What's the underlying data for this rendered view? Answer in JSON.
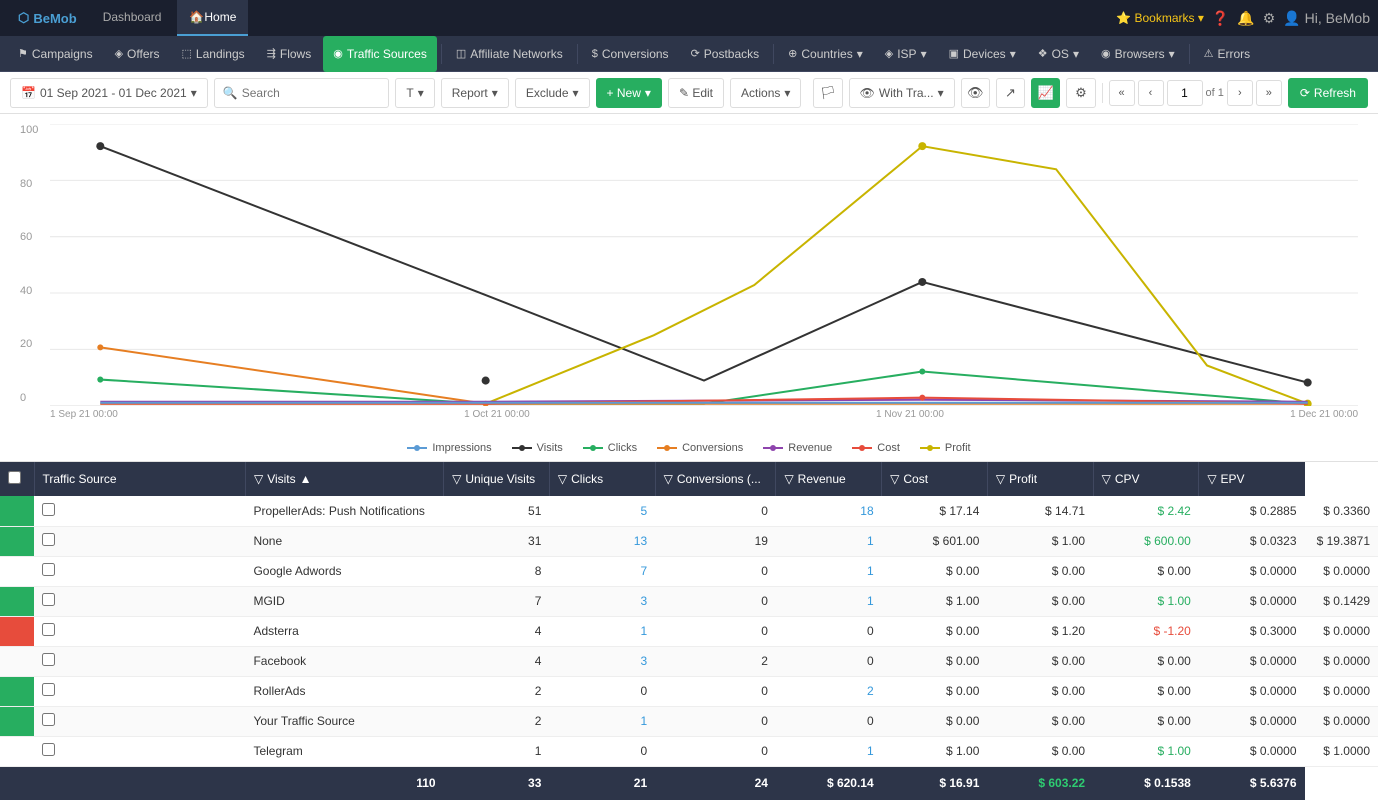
{
  "topbar": {
    "brand": "BeMob",
    "tabs": [
      {
        "label": "Dashboard",
        "active": false
      },
      {
        "label": "Home",
        "active": true
      }
    ],
    "bookmarks": "Bookmarks",
    "hi": "Hi, BeMob"
  },
  "navbar": {
    "items": [
      {
        "label": "Campaigns",
        "icon": "⚑",
        "active": false
      },
      {
        "label": "Offers",
        "icon": "◈",
        "active": false
      },
      {
        "label": "Landings",
        "icon": "⬚",
        "active": false
      },
      {
        "label": "Flows",
        "icon": "⇶",
        "active": false
      },
      {
        "label": "Traffic Sources",
        "icon": "◉",
        "active": true
      },
      {
        "label": "Affiliate Networks",
        "icon": "◫",
        "active": false
      },
      {
        "label": "Conversions",
        "icon": "$",
        "active": false
      },
      {
        "label": "Postbacks",
        "icon": "⟳",
        "active": false
      },
      {
        "label": "Countries",
        "icon": "⊕",
        "active": false
      },
      {
        "label": "ISP",
        "icon": "◈",
        "active": false
      },
      {
        "label": "Devices",
        "icon": "▣",
        "active": false
      },
      {
        "label": "OS",
        "icon": "❖",
        "active": false
      },
      {
        "label": "Browsers",
        "icon": "◉",
        "active": false
      },
      {
        "label": "Errors",
        "icon": "⚠",
        "active": false
      }
    ]
  },
  "toolbar": {
    "date_range": "01 Sep 2021 - 01 Dec 2021",
    "search_placeholder": "Search",
    "buttons": {
      "type": "T",
      "report": "Report",
      "exclude": "Exclude",
      "new": "+ New",
      "edit": "✎ Edit",
      "actions": "Actions",
      "with_tra": "With Tra...",
      "refresh": "Refresh"
    },
    "page_current": "1",
    "page_total": "1"
  },
  "chart": {
    "y_labels": [
      "100",
      "80",
      "60",
      "40",
      "20",
      "0"
    ],
    "x_labels": [
      "1 Sep 21 00:00",
      "1 Oct 21 00:00",
      "1 Nov 21 00:00",
      "1 Dec 21 00:00"
    ],
    "legend": [
      {
        "label": "Impressions",
        "color": "#5b9bd5"
      },
      {
        "label": "Visits",
        "color": "#333"
      },
      {
        "label": "Clicks",
        "color": "#27ae60"
      },
      {
        "label": "Conversions",
        "color": "#e67e22"
      },
      {
        "label": "Revenue",
        "color": "#8e44ad"
      },
      {
        "label": "Cost",
        "color": "#e74c3c"
      },
      {
        "label": "Profit",
        "color": "#c8b400"
      }
    ]
  },
  "table": {
    "columns": [
      {
        "label": "Traffic Source",
        "key": "source"
      },
      {
        "label": "Visits",
        "key": "visits"
      },
      {
        "label": "Unique Visits",
        "key": "unique_visits"
      },
      {
        "label": "Clicks",
        "key": "clicks"
      },
      {
        "label": "Conversions (...",
        "key": "conversions"
      },
      {
        "label": "Revenue",
        "key": "revenue"
      },
      {
        "label": "Cost",
        "key": "cost"
      },
      {
        "label": "Profit",
        "key": "profit"
      },
      {
        "label": "CPV",
        "key": "cpv"
      },
      {
        "label": "EPV",
        "key": "epv"
      }
    ],
    "rows": [
      {
        "source": "PropellerAds: Push Notifications",
        "visits": "51",
        "unique_visits": "5",
        "clicks": "0",
        "conversions": "18",
        "revenue": "$ 17.14",
        "cost": "$ 14.71",
        "profit": "$ 2.42",
        "cpv": "$ 0.2885",
        "epv": "$ 0.3360",
        "profit_type": "positive",
        "add": true,
        "sub": false
      },
      {
        "source": "None",
        "visits": "31",
        "unique_visits": "13",
        "clicks": "19",
        "conversions": "1",
        "revenue": "$ 601.00",
        "cost": "$ 1.00",
        "profit": "$ 600.00",
        "cpv": "$ 0.0323",
        "epv": "$ 19.3871",
        "profit_type": "positive",
        "add": true,
        "sub": false
      },
      {
        "source": "Google Adwords",
        "visits": "8",
        "unique_visits": "7",
        "clicks": "0",
        "conversions": "1",
        "revenue": "$ 0.00",
        "cost": "$ 0.00",
        "profit": "$ 0.00",
        "cpv": "$ 0.0000",
        "epv": "$ 0.0000",
        "profit_type": "neutral",
        "add": false,
        "sub": false
      },
      {
        "source": "MGID",
        "visits": "7",
        "unique_visits": "3",
        "clicks": "0",
        "conversions": "1",
        "revenue": "$ 1.00",
        "cost": "$ 0.00",
        "profit": "$ 1.00",
        "cpv": "$ 0.0000",
        "epv": "$ 0.1429",
        "profit_type": "positive",
        "add": true,
        "sub": false
      },
      {
        "source": "Adsterra",
        "visits": "4",
        "unique_visits": "1",
        "clicks": "0",
        "conversions": "0",
        "revenue": "$ 0.00",
        "cost": "$ 1.20",
        "profit": "$ -1.20",
        "cpv": "$ 0.3000",
        "epv": "$ 0.0000",
        "profit_type": "negative",
        "add": false,
        "sub": true
      },
      {
        "source": "Facebook",
        "visits": "4",
        "unique_visits": "3",
        "clicks": "2",
        "conversions": "0",
        "revenue": "$ 0.00",
        "cost": "$ 0.00",
        "profit": "$ 0.00",
        "cpv": "$ 0.0000",
        "epv": "$ 0.0000",
        "profit_type": "neutral",
        "add": false,
        "sub": false
      },
      {
        "source": "RollerAds",
        "visits": "2",
        "unique_visits": "0",
        "clicks": "0",
        "conversions": "2",
        "revenue": "$ 0.00",
        "cost": "$ 0.00",
        "profit": "$ 0.00",
        "cpv": "$ 0.0000",
        "epv": "$ 0.0000",
        "profit_type": "neutral",
        "add": true,
        "sub": false
      },
      {
        "source": "Your Traffic Source",
        "visits": "2",
        "unique_visits": "1",
        "clicks": "0",
        "conversions": "0",
        "revenue": "$ 0.00",
        "cost": "$ 0.00",
        "profit": "$ 0.00",
        "cpv": "$ 0.0000",
        "epv": "$ 0.0000",
        "profit_type": "neutral",
        "add": true,
        "sub": false
      },
      {
        "source": "Telegram",
        "visits": "1",
        "unique_visits": "0",
        "clicks": "0",
        "conversions": "1",
        "revenue": "$ 1.00",
        "cost": "$ 0.00",
        "profit": "$ 1.00",
        "cpv": "$ 0.0000",
        "epv": "$ 1.0000",
        "profit_type": "positive",
        "add": false,
        "sub": false
      }
    ],
    "footer": {
      "visits": "110",
      "unique_visits": "33",
      "clicks": "21",
      "conversions": "24",
      "revenue": "$ 620.14",
      "cost": "$ 16.91",
      "profit": "$ 603.22",
      "cpv": "$ 0.1538",
      "epv": "$ 5.6376"
    }
  }
}
